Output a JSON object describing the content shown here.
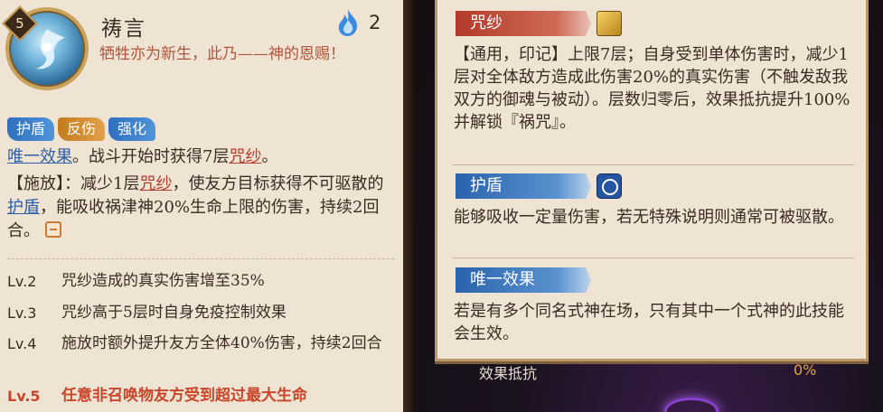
{
  "skill": {
    "level": "5",
    "name": "祷言",
    "cost": "2",
    "quote": "牺牲亦为新生，此乃——神的恩赐！",
    "tags": [
      "护盾",
      "反伤",
      "强化"
    ],
    "passive_keyword": "唯一效果",
    "passive_text_1": "。战斗开始时获得7层",
    "passive_mark": "咒纱",
    "passive_text_2": "。",
    "cast_label": "【施放】：减少1层",
    "cast_mark": "咒纱",
    "cast_text_1": "，使友方目标获得不可驱散的",
    "cast_shield": "护盾",
    "cast_text_2": "，能吸收祸津神20%生命上限的伤害，持续2回合。",
    "levels": [
      {
        "label": "Lv.2",
        "text": "咒纱造成的真实伤害增至35%"
      },
      {
        "label": "Lv.3",
        "text": "咒纱高于5层时自身免疫控制效果"
      },
      {
        "label": "Lv.4",
        "text": "施放时额外提升友方全体40%伤害，持续2回合"
      },
      {
        "label": "Lv.5",
        "text": "任意非召唤物友方受到超过最大生命"
      }
    ]
  },
  "popup": {
    "sections": [
      {
        "title": "咒纱",
        "text": "【通用，印记】上限7层；自身受到单体伤害时，减少1层对全体敌方造成此伤害20%的真实伤害（不触发敌我双方的御魂与被动）。层数归零后，效果抵抗提升100%并解锁『祸咒』。"
      },
      {
        "title": "护盾",
        "text": "能够吸收一定量伤害，若无特殊说明则通常可被驱散。"
      },
      {
        "title": "唯一效果",
        "text": "若是有多个同名式神在场，只有其中一个式神的此技能会生效。"
      }
    ]
  },
  "stats": {
    "label": "效果抵抗",
    "value": "0%"
  },
  "colors": {
    "panel_bg": "#efe3d3",
    "keyword_blue": "#2d5fa8",
    "keyword_red": "#b63b2a",
    "max_level": "#c8462a",
    "stat_value": "#e3a33a"
  },
  "icons": {
    "skill": "skill-portrait-icon",
    "cost": "blue-flame-icon",
    "mark": "gold-mark-icon",
    "shield": "shield-badge-icon",
    "collapse": "collapse-icon"
  }
}
